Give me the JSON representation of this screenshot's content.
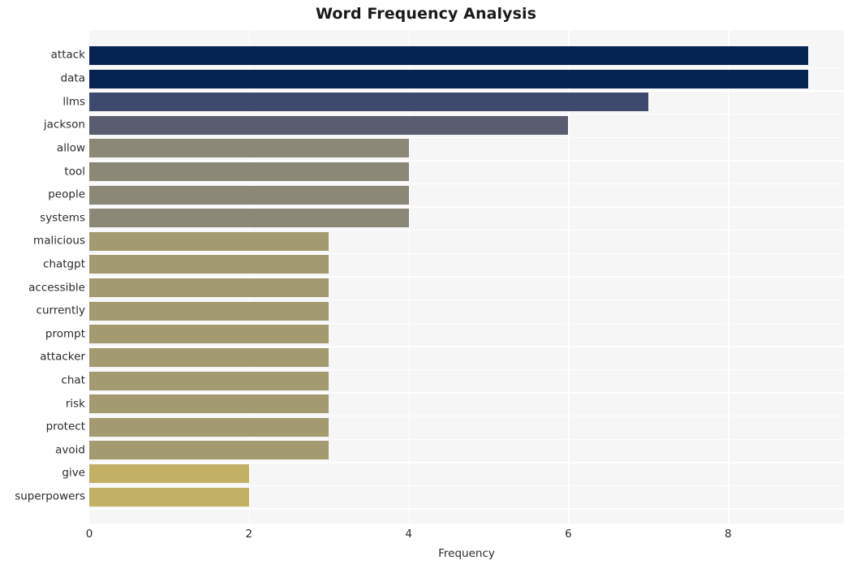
{
  "chart_data": {
    "type": "bar",
    "orientation": "horizontal",
    "title": "Word Frequency Analysis",
    "xlabel": "Frequency",
    "ylabel": "",
    "categories": [
      "attack",
      "data",
      "llms",
      "jackson",
      "allow",
      "tool",
      "people",
      "systems",
      "malicious",
      "chatgpt",
      "accessible",
      "currently",
      "prompt",
      "attacker",
      "chat",
      "risk",
      "protect",
      "avoid",
      "give",
      "superpowers"
    ],
    "values": [
      9,
      9,
      7,
      6,
      4,
      4,
      4,
      4,
      3,
      3,
      3,
      3,
      3,
      3,
      3,
      3,
      3,
      3,
      2,
      2
    ],
    "bar_colors": [
      "#042351",
      "#042351",
      "#3d4a6e",
      "#5a5c70",
      "#8b8878",
      "#8b8878",
      "#8b8878",
      "#8b8878",
      "#a39a70",
      "#a39a70",
      "#a39a70",
      "#a39a70",
      "#a39a70",
      "#a39a70",
      "#a39a70",
      "#a39a70",
      "#a39a70",
      "#a39a70",
      "#c2b165",
      "#c2b165"
    ],
    "xlim": [
      0,
      9.45
    ],
    "xticks": [
      0,
      2,
      4,
      6,
      8
    ],
    "xticklabels": [
      "0",
      "2",
      "4",
      "6",
      "8"
    ],
    "grid": true,
    "grid_color": "#ffffff",
    "plot_background": "#f6f6f7",
    "figure_background": "#ffffff",
    "legend": "none",
    "axis_text_color": "#2b2b2b"
  }
}
